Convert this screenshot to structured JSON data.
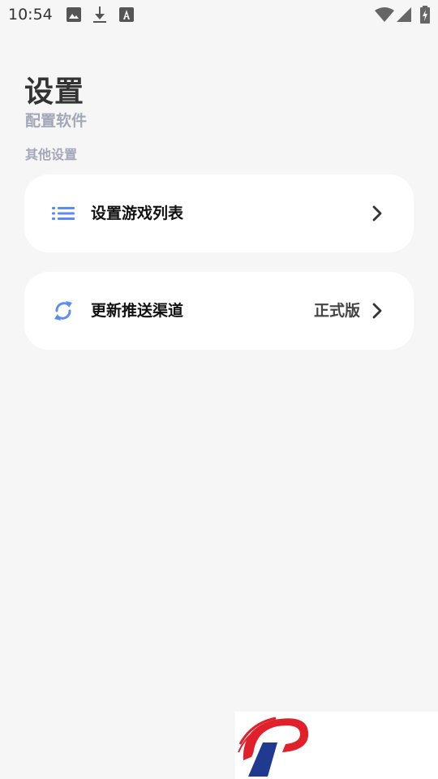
{
  "status_bar": {
    "time": "10:54",
    "icons": [
      "image-notification-icon",
      "download-icon",
      "font-a-icon",
      "wifi-icon",
      "signal-icon",
      "battery-charging-icon"
    ]
  },
  "header": {
    "title": "设置",
    "subtitle": "配置软件"
  },
  "section": {
    "label": "其他设置"
  },
  "items": [
    {
      "label": "设置游戏列表",
      "icon": "list-icon",
      "value": ""
    },
    {
      "label": "更新推送渠道",
      "icon": "sync-icon",
      "value": "正式版"
    }
  ],
  "colors": {
    "background": "#f6f6f6",
    "card": "#ffffff",
    "accent_icon": "#5b8def",
    "muted_text": "#a3a8b8",
    "logo_red": "#e0202a",
    "logo_blue": "#1f3a8f"
  },
  "ad_banner": {
    "logo": "red-blue-p-logo"
  }
}
